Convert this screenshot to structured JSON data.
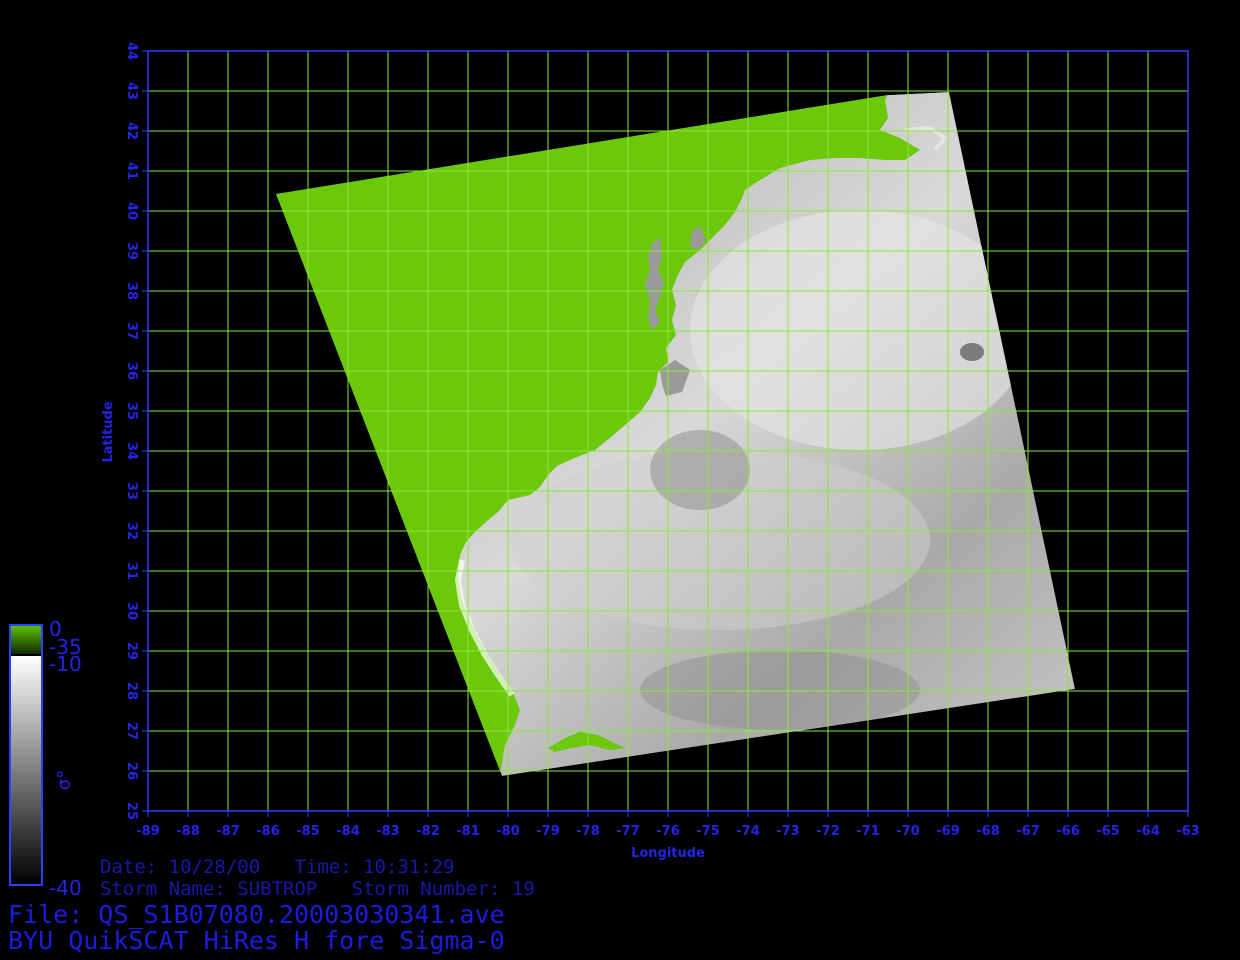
{
  "map": {
    "lon_min": -89,
    "lon_max": -63,
    "lat_min": 25,
    "lat_max": 44,
    "lon_ticks": [
      "-89",
      "-88",
      "-87",
      "-86",
      "-85",
      "-84",
      "-83",
      "-82",
      "-81",
      "-80",
      "-79",
      "-78",
      "-77",
      "-76",
      "-75",
      "-74",
      "-73",
      "-72",
      "-71",
      "-70",
      "-69",
      "-68",
      "-67",
      "-66",
      "-65",
      "-64",
      "-63"
    ],
    "lat_ticks": [
      "25",
      "26",
      "27",
      "28",
      "29",
      "30",
      "31",
      "32",
      "33",
      "34",
      "35",
      "36",
      "37",
      "38",
      "39",
      "40",
      "41",
      "42",
      "43",
      "44"
    ],
    "xlabel": "Longitude",
    "ylabel": "Latitude",
    "grid": true,
    "colors": {
      "land": "#6cc80a",
      "grid": "#8ce63c",
      "frame": "#2a40ff",
      "axis_text": "#2424e6",
      "background": "#000000",
      "ocean_light": "#d8d8d8",
      "ocean_dark": "#6a6a6a"
    }
  },
  "colorbar": {
    "labels": [
      "0",
      "-35",
      "-10",
      "-40"
    ],
    "symbol": "σ°",
    "land_color": "#5cbe00",
    "top_value": "0",
    "green_low": "-35",
    "gray_high": "-10",
    "bottom_value": "-40"
  },
  "info": {
    "date_line": "Date: 10/28/00   Time: 10:31:29",
    "storm_line": "Storm Name: SUBTROP   Storm Number: 19",
    "file_line": "File: QS_S1B07080.20003030341.ave",
    "title_line": "BYU QuikSCAT HiRes H fore Sigma-0"
  }
}
